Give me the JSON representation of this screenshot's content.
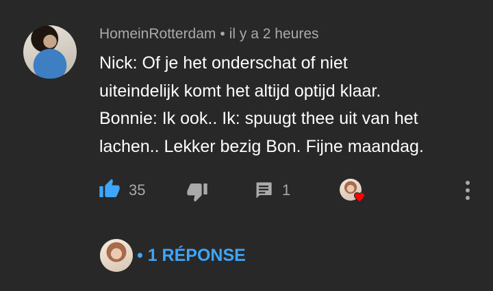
{
  "comment": {
    "author": "HomeinRotterdam",
    "separator": "•",
    "timestamp": "il y a 2 heures",
    "text_lines": [
      "Nick: Of je het onderschat of niet",
      "uiteindelijk komt het altijd optijd klaar.",
      "Bonnie: Ik ook.. Ik: spuugt thee uit van het",
      "lachen.. Lekker bezig Bon. Fijne maandag."
    ],
    "likes": "35",
    "reply_count": "1",
    "replies_link": "• 1 RÉPONSE"
  },
  "colors": {
    "background": "#282828",
    "meta_text": "#aaaaaa",
    "link_blue": "#3ea6ff",
    "like_active": "#3ea6ff",
    "heart": "#ff0000"
  },
  "icons": {
    "like": "thumbs-up-icon",
    "dislike": "thumbs-down-icon",
    "reply": "comment-icon",
    "heart": "heart-icon",
    "more": "more-vertical-icon"
  }
}
